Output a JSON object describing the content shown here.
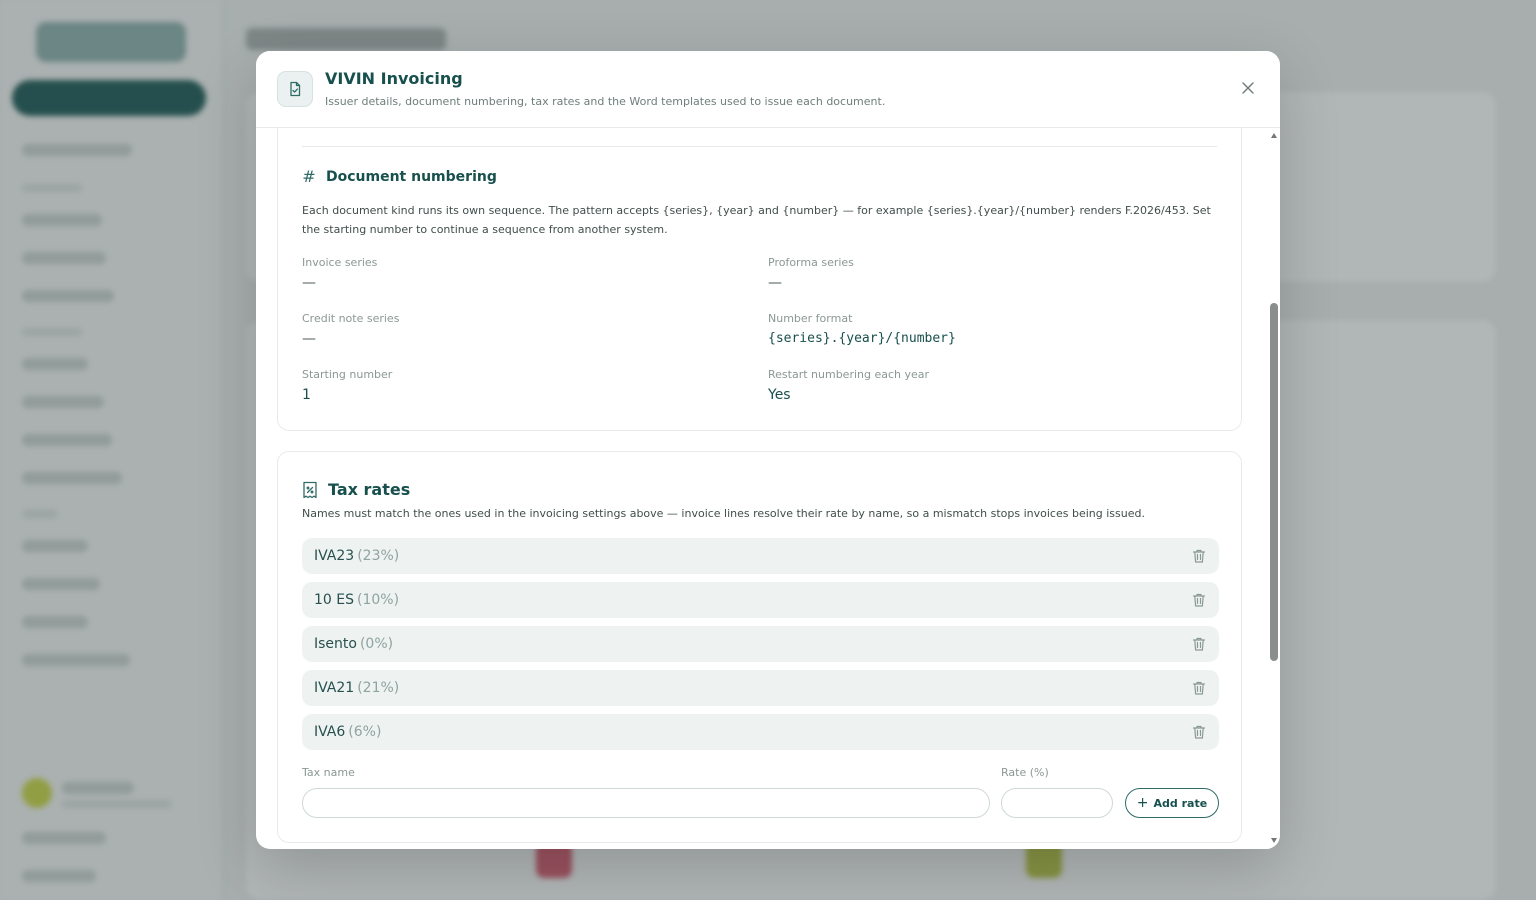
{
  "modal": {
    "title": "VIVIN Invoicing",
    "subtitle": "Issuer details, document numbering, tax rates and the Word templates used to issue each document.",
    "icon": "document-check-icon"
  },
  "numbering": {
    "heading": "Document numbering",
    "description": "Each document kind runs its own sequence. The pattern accepts {series}, {year} and {number} — for example {series}.{year}/{number} renders F.2026/453. Set the starting number to continue a sequence from another system.",
    "fields": {
      "invoice_series": {
        "label": "Invoice series",
        "value": "—"
      },
      "proforma_series": {
        "label": "Proforma series",
        "value": "—"
      },
      "credit_note_series": {
        "label": "Credit note series",
        "value": "—"
      },
      "number_format": {
        "label": "Number format",
        "value": "{series}.{year}/{number}"
      },
      "starting_number": {
        "label": "Starting number",
        "value": "1"
      },
      "restart_yearly": {
        "label": "Restart numbering each year",
        "value": "Yes"
      }
    }
  },
  "tax": {
    "heading": "Tax rates",
    "description": "Names must match the ones used in the invoicing settings above — invoice lines resolve their rate by name, so a mismatch stops invoices being issued.",
    "rates": [
      {
        "name": "IVA23",
        "pct": "(23%)"
      },
      {
        "name": "10 ES",
        "pct": "(10%)"
      },
      {
        "name": "Isento",
        "pct": "(0%)"
      },
      {
        "name": "IVA21",
        "pct": "(21%)"
      },
      {
        "name": "IVA6",
        "pct": "(6%)"
      }
    ],
    "form": {
      "name_label": "Tax name",
      "name_value": "",
      "rate_label": "Rate (%)",
      "rate_value": "",
      "add_label": "Add rate"
    }
  },
  "colors": {
    "primary": "#17504d",
    "row_bg": "#eef3f2",
    "muted": "#8b9896"
  }
}
